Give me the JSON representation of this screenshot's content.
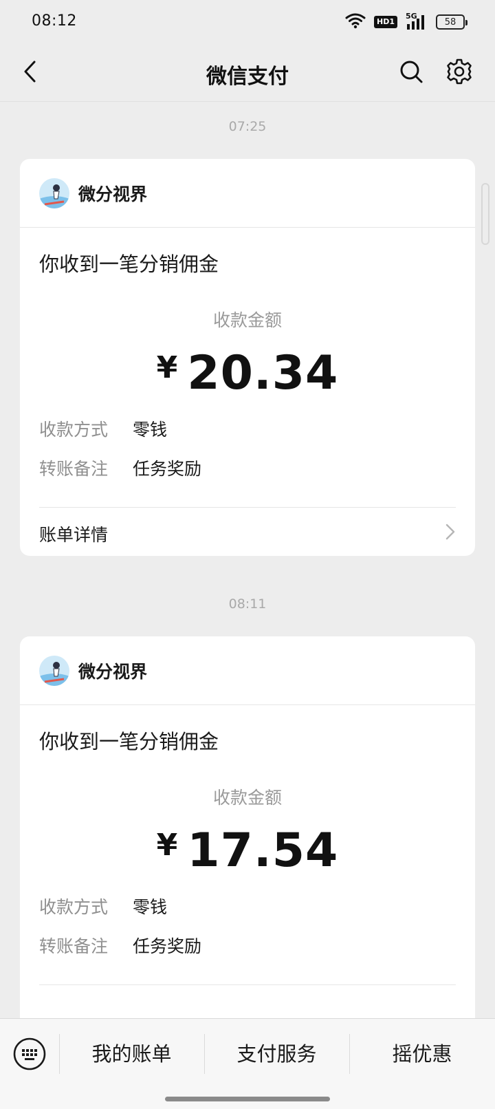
{
  "status_bar": {
    "time": "08:12",
    "hd_label": "HD1",
    "network_label": "5G",
    "battery_level": "58",
    "icons": [
      "wifi-icon",
      "hd-icon",
      "signal-5g-icon",
      "battery-icon"
    ]
  },
  "nav": {
    "title": "微信支付",
    "icons": [
      "back-chevron-icon",
      "search-icon",
      "gear-icon"
    ]
  },
  "messages": [
    {
      "time": "07:25",
      "sender": "微分视界",
      "title": "你收到一笔分销佣金",
      "amount_label": "收款金额",
      "currency": "¥",
      "amount": "20.34",
      "details": [
        {
          "key": "收款方式",
          "value": "零钱"
        },
        {
          "key": "转账备注",
          "value": "任务奖励"
        }
      ],
      "link": "账单详情"
    },
    {
      "time": "08:11",
      "sender": "微分视界",
      "title": "你收到一笔分销佣金",
      "amount_label": "收款金额",
      "currency": "¥",
      "amount": "17.54",
      "details": [
        {
          "key": "收款方式",
          "value": "零钱"
        },
        {
          "key": "转账备注",
          "value": "任务奖励"
        }
      ]
    }
  ],
  "bottom_menu": {
    "items": [
      "我的账单",
      "支付服务",
      "摇优惠"
    ],
    "keyboard_icon": "keyboard-icon"
  },
  "colors": {
    "background": "#ededed",
    "card": "#ffffff",
    "muted_text": "#9a9a9a",
    "primary_text": "#111111"
  }
}
